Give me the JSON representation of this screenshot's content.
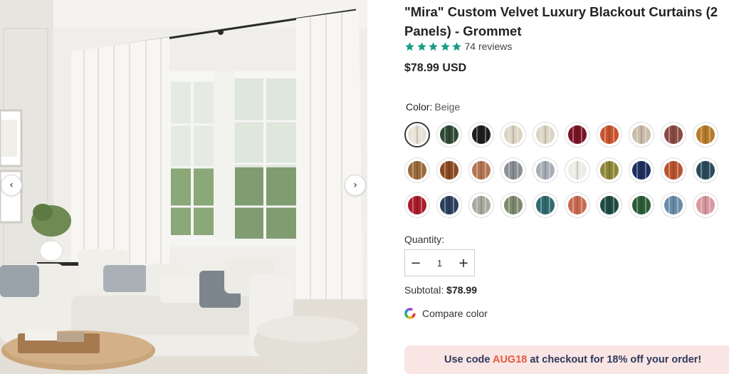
{
  "gallery": {
    "prev_arrow": "‹",
    "next_arrow": "›"
  },
  "product": {
    "title": "\"Mira\" Custom Velvet Luxury Blackout Curtains (2 Panels) - Grommet",
    "rating": {
      "stars": 5,
      "review_count": "74 reviews",
      "star_color": "#1a9c87"
    },
    "price": "$78.99 USD"
  },
  "color": {
    "label": "Color:",
    "selected": "Beige",
    "swatches": [
      [
        "#e8e2d6",
        "#2e4a34",
        "#1d1d1d",
        "#ddd3c2",
        "#dcd4c4",
        "#7a1426",
        "#c9532e",
        "#c9bca8",
        "#8a4a44",
        "#b87a2a"
      ],
      [
        "#9a6a3a",
        "#8a4a22",
        "#b47652",
        "#8a8e95",
        "#a7adb7",
        "#ecebe5",
        "#8d8636",
        "#1e2e5e",
        "#b8532e",
        "#2a4a5c"
      ],
      [
        "#a81c2a",
        "#2b3f5c",
        "#a7ab9e",
        "#7e8a6e",
        "#2e6a70",
        "#c86a52",
        "#1e4a44",
        "#2a5c36",
        "#6a8caa",
        "#d898a0"
      ]
    ]
  },
  "quantity": {
    "label": "Quantity:",
    "value": "1",
    "minus": "−",
    "plus": "+"
  },
  "subtotal": {
    "label": "Subtotal:",
    "value": "$78.99"
  },
  "compare": {
    "label": "Compare color"
  },
  "promo": {
    "prefix": "Use code ",
    "code": "AUG18",
    "suffix": " at checkout for 18% off your order!"
  }
}
